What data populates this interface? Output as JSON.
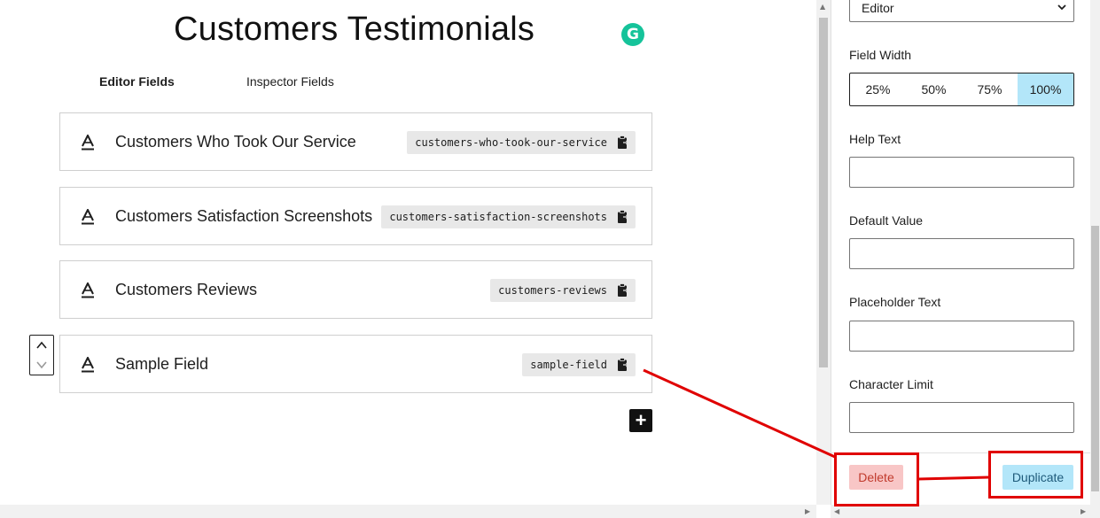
{
  "page": {
    "title": "Customers Testimonials"
  },
  "extension": {
    "grammarly_letter": "G"
  },
  "tabs": [
    {
      "label": "Editor Fields",
      "active": true
    },
    {
      "label": "Inspector Fields",
      "active": false
    }
  ],
  "fields": [
    {
      "label": "Customers Who Took Our Service",
      "slug": "customers-who-took-our-service",
      "icon": "text-field-icon"
    },
    {
      "label": "Customers Satisfaction Screenshots",
      "slug": "customers-satisfaction-screenshots",
      "icon": "text-field-icon"
    },
    {
      "label": "Customers Reviews",
      "slug": "customers-reviews",
      "icon": "text-field-icon"
    },
    {
      "label": "Sample Field",
      "slug": "sample-field",
      "icon": "text-field-icon",
      "selected": true
    }
  ],
  "add_button": {
    "label": "+"
  },
  "inspector": {
    "location_select": {
      "value": "Editor"
    },
    "field_width": {
      "label": "Field Width",
      "options": [
        "25%",
        "50%",
        "75%",
        "100%"
      ],
      "selected": "100%"
    },
    "help_text": {
      "label": "Help Text",
      "value": ""
    },
    "default_value": {
      "label": "Default Value",
      "value": ""
    },
    "placeholder_text": {
      "label": "Placeholder Text",
      "value": ""
    },
    "character_limit": {
      "label": "Character Limit",
      "value": ""
    },
    "delete_button": "Delete",
    "duplicate_button": "Duplicate"
  },
  "colors": {
    "selected_width": "#b3e6f9",
    "delete_bg": "#f8c6c6",
    "duplicate_bg": "#b3e6f9",
    "annotation": "#e00000",
    "grammarly": "#15c39a"
  }
}
